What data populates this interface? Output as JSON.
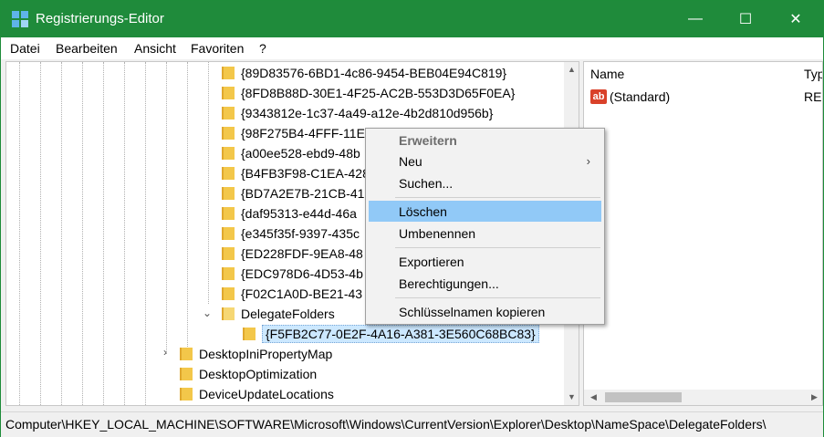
{
  "window": {
    "title": "Registrierungs-Editor",
    "minimize": "—",
    "maximize": "☐",
    "close": "✕",
    "accent_color": "#1f8b3b"
  },
  "menubar": [
    "Datei",
    "Bearbeiten",
    "Ansicht",
    "Favoriten",
    "?"
  ],
  "tree": {
    "items": [
      {
        "label": "{89D83576-6BD1-4c86-9454-BEB04E94C819}"
      },
      {
        "label": "{8FD8B88D-30E1-4F25-AC2B-553D3D65F0EA}"
      },
      {
        "label": "{9343812e-1c37-4a49-a12e-4b2d810d956b}"
      },
      {
        "label": "{98F275B4-4FFF-11E"
      },
      {
        "label": "{a00ee528-ebd9-48b"
      },
      {
        "label": "{B4FB3F98-C1EA-428"
      },
      {
        "label": "{BD7A2E7B-21CB-41"
      },
      {
        "label": "{daf95313-e44d-46a"
      },
      {
        "label": "{e345f35f-9397-435c"
      },
      {
        "label": "{ED228FDF-9EA8-48"
      },
      {
        "label": "{EDC978D6-4D53-4b"
      },
      {
        "label": "{F02C1A0D-BE21-43"
      },
      {
        "label": "DelegateFolders"
      },
      {
        "label": "{F5FB2C77-0E2F-4A16-A381-3E560C68BC83}"
      },
      {
        "label": "DesktopIniPropertyMap"
      },
      {
        "label": "DesktopOptimization"
      },
      {
        "label": "DeviceUpdateLocations"
      }
    ],
    "expanded_glyph": "⌄",
    "collapsed_glyph": "›"
  },
  "list": {
    "columns": [
      "Name",
      "Typ"
    ],
    "rows": [
      {
        "name": "(Standard)",
        "type": "RE",
        "icon": "ab-string-icon",
        "icon_text": "ab"
      }
    ]
  },
  "context_menu": {
    "items": [
      "Erweitern",
      "Neu",
      "Suchen...",
      "Löschen",
      "Umbenennen",
      "Exportieren",
      "Berechtigungen...",
      "Schlüsselnamen kopieren"
    ],
    "submenu_arrow": "›",
    "highlighted": "Löschen",
    "highlight_color": "#91c9f7"
  },
  "scroll": {
    "up": "▲",
    "down": "▼",
    "left": "◀",
    "right": "▶"
  },
  "status": "Computer\\HKEY_LOCAL_MACHINE\\SOFTWARE\\Microsoft\\Windows\\CurrentVersion\\Explorer\\Desktop\\NameSpace\\DelegateFolders\\"
}
